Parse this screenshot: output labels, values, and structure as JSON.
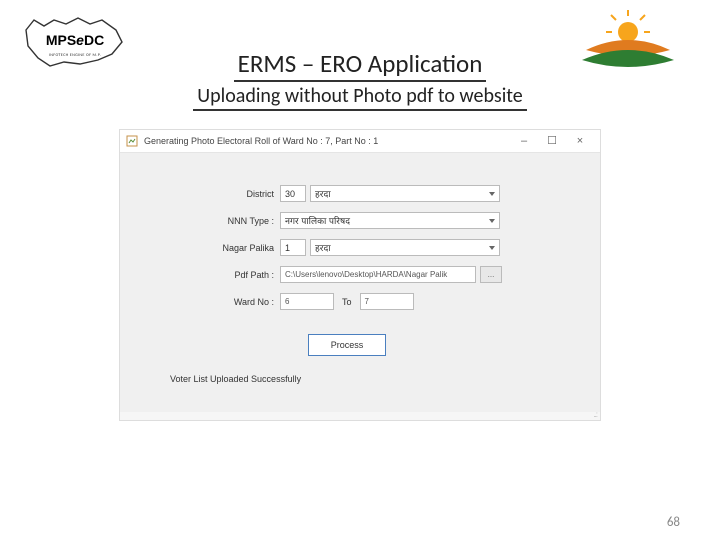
{
  "slide": {
    "title": "ERMS – ERO Application",
    "subtitle": "Uploading without Photo pdf to website",
    "page_number": "68"
  },
  "logos": {
    "left_name": "MPS@DC",
    "left_tagline": "INFOTECH ENGINE OF M.P."
  },
  "window": {
    "title": "Generating Photo Electoral Roll of Ward No : 7, Part No : 1",
    "min_label": "–",
    "max_label": "☐",
    "close_label": "×"
  },
  "form": {
    "district": {
      "label": "District",
      "code": "30",
      "value": "हरदा"
    },
    "nnn_type": {
      "label": "NNN Type :",
      "value": "नगर पालिका परिषद"
    },
    "nagar_palika": {
      "label": "Nagar Palika",
      "code": "1",
      "value": "हरदा"
    },
    "pdf_path": {
      "label": "Pdf Path :",
      "value": "C:\\Users\\lenovo\\Desktop\\HARDA\\Nagar Palik",
      "browse": "..."
    },
    "ward_no": {
      "label": "Ward No :",
      "from": "6",
      "to_label": "To",
      "to": "7"
    },
    "process_label": "Process",
    "status": "Voter List Uploaded Successfully"
  }
}
